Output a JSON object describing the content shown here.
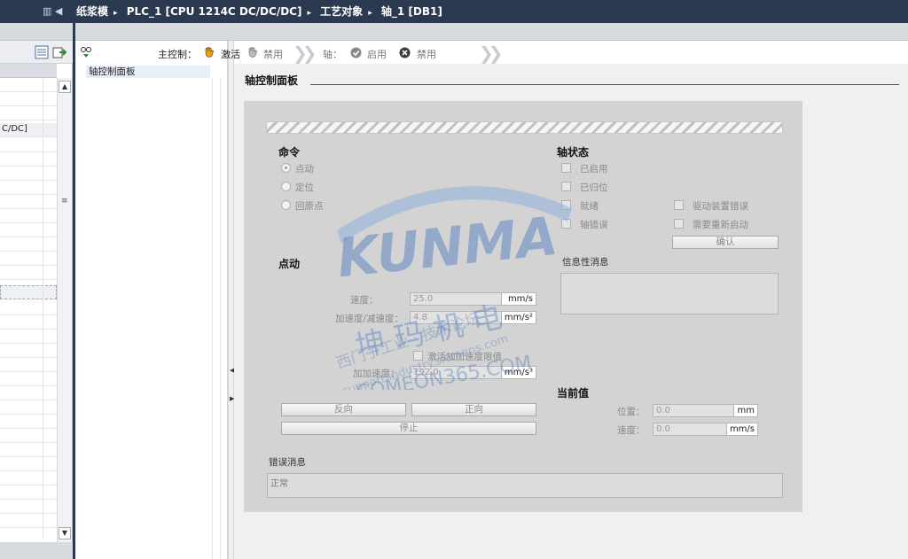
{
  "window": {
    "breadcrumb": [
      "纸浆模",
      "PLC_1 [CPU 1214C DC/DC/DC]",
      "工艺对象",
      "轴_1 [DB1]"
    ],
    "left_partial_text": "C/DC]"
  },
  "toolbar": {
    "master_control_label": "主控制：",
    "activate_label": "激活",
    "deactivate_label": "禁用",
    "axis_label": "轴：",
    "enable_label": "启用",
    "disable_label": "禁用"
  },
  "tree": {
    "selected_item": "轴控制面板"
  },
  "panel": {
    "title": "轴控制面板",
    "command": {
      "heading": "命令",
      "options": [
        "点动",
        "定位",
        "回原点"
      ],
      "selected": "点动"
    },
    "axis_status": {
      "heading": "轴状态",
      "left_items": [
        "已启用",
        "已归位",
        "就绪",
        "轴错误"
      ],
      "right_items": [
        "驱动装置错误",
        "需要重新启动"
      ],
      "confirm_label": "确认",
      "info_label": "信息性消息"
    },
    "jog": {
      "heading": "点动",
      "speed_label": "速度：",
      "speed_value": "25.0",
      "speed_unit": "mm/s",
      "accel_label": "加速度/减速度：",
      "accel_value": "4.8",
      "accel_unit": "mm/s²",
      "jerk_checkbox_label": "激活加加速度限值",
      "jerk_label": "加加速度：",
      "jerk_value": "192.0",
      "jerk_unit": "mm/s³",
      "backward_label": "反向",
      "forward_label": "正向",
      "stop_label": "停止"
    },
    "current_values": {
      "heading": "当前值",
      "position_label": "位置：",
      "position_value": "0.0",
      "position_unit": "mm",
      "velocity_label": "速度：",
      "velocity_value": "0.0",
      "velocity_unit": "mm/s"
    },
    "error": {
      "heading": "错误消息",
      "message": "正常"
    }
  },
  "watermark": {
    "brand": "KUNMA",
    "line1": "西门子工业 · 技术论坛",
    "line2": "support.industry.siemens.com",
    "line3": "坤 玛 机 电",
    "line4": "COMEON365.COM"
  },
  "colors": {
    "titlebar": "#2b3a50",
    "panel_bg": "#d3d3d3",
    "watermark_blue": "#3f6fb4"
  }
}
